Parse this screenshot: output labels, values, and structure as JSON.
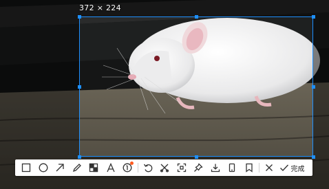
{
  "capture": {
    "size_label": "372 × 224"
  },
  "toolbar": {
    "tools": [
      {
        "name": "rectangle-tool",
        "icon": "rectangle-icon"
      },
      {
        "name": "ellipse-tool",
        "icon": "ellipse-icon"
      },
      {
        "name": "arrow-tool",
        "icon": "arrow-icon"
      },
      {
        "name": "pencil-tool",
        "icon": "pencil-icon"
      },
      {
        "name": "mosaic-tool",
        "icon": "mosaic-icon"
      },
      {
        "name": "text-tool",
        "icon": "text-icon"
      },
      {
        "name": "sequence-number-tool",
        "icon": "numbered-circle-icon"
      },
      {
        "name": "undo-button",
        "icon": "undo-icon"
      },
      {
        "name": "crop-button",
        "icon": "crop-icon"
      },
      {
        "name": "fullscreen-button",
        "icon": "expand-icon"
      },
      {
        "name": "pin-button",
        "icon": "pin-icon"
      },
      {
        "name": "download-button",
        "icon": "download-icon"
      },
      {
        "name": "phone-button",
        "icon": "phone-icon"
      },
      {
        "name": "bookmark-button",
        "icon": "bookmark-icon"
      },
      {
        "name": "close-button",
        "icon": "close-icon"
      }
    ],
    "done_label": "完成"
  },
  "colors": {
    "selection": "#1e90ff",
    "badge": "#ff5a1f"
  }
}
